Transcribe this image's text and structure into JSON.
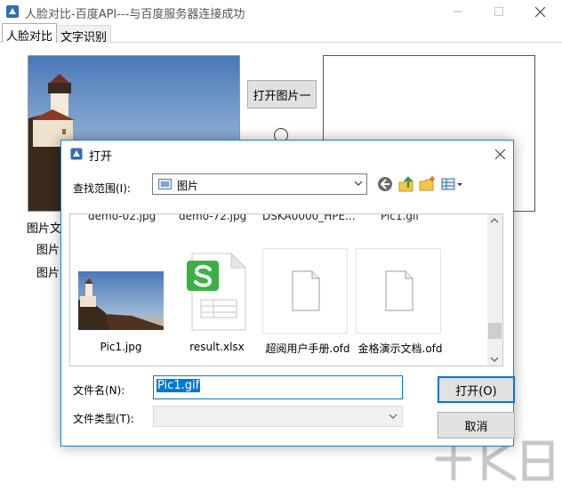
{
  "window": {
    "title": "人脸对比-百度API---与百度服务器连接成功"
  },
  "tabs": [
    {
      "label": "人脸对比",
      "active": true
    },
    {
      "label": "文字识别",
      "active": false
    }
  ],
  "main": {
    "open_image1_label": "打开图片一",
    "labels": [
      "图片文",
      "图片",
      "图片"
    ]
  },
  "dialog": {
    "title": "打开",
    "look_in_label": "查找范围(I):",
    "look_in_value": "图片",
    "partial_labels": [
      "demo-02.jpg",
      "demo-72.jpg",
      "DSKA0000_HPE...",
      "Pic1.gif"
    ],
    "files": [
      {
        "name": "Pic1.jpg",
        "icon": "image-thumbnail"
      },
      {
        "name": "result.xlsx",
        "icon": "spreadsheet-icon"
      },
      {
        "name": "超阅用户手册.ofd",
        "icon": "document-icon"
      },
      {
        "name": "金格演示文档.ofd",
        "icon": "document-icon"
      }
    ],
    "filename_label": "文件名(N):",
    "filename_value": "Pic1.gif",
    "filetype_label": "文件类型(T):",
    "filetype_value": "",
    "open_button": "打开(O)",
    "cancel_button": "取消"
  },
  "colors": {
    "accent": "#0078d7",
    "spreadsheet_green": "#3cb043"
  }
}
